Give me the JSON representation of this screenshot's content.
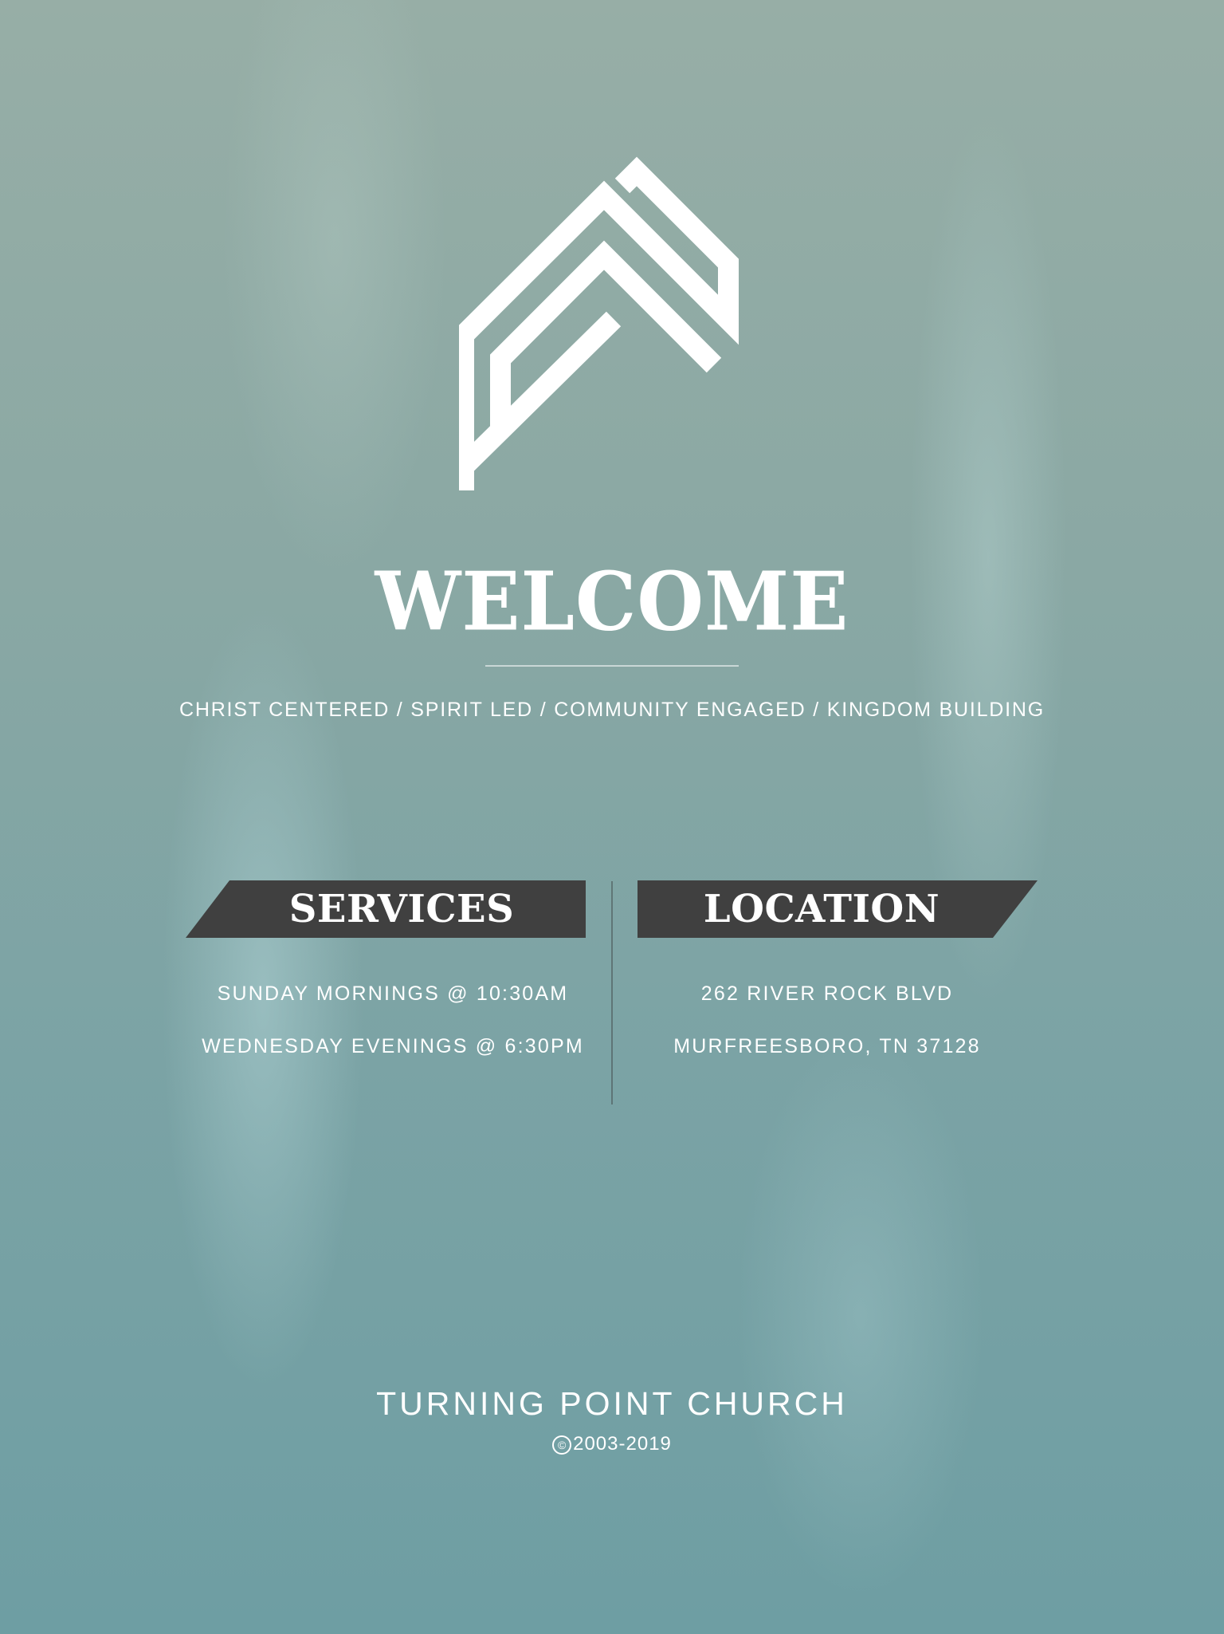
{
  "logo": {
    "icon": "chevron-house-logo-icon",
    "color": "#ffffff"
  },
  "heading": {
    "title": "WELCOME"
  },
  "tagline": "CHRIST CENTERED / SPIRIT LED / COMMUNITY ENGAGED / KINGDOM BUILDING",
  "services": {
    "label": "SERVICES",
    "lines": [
      "SUNDAY MORNINGS @ 10:30AM",
      "WEDNESDAY EVENINGS @ 6:30PM"
    ]
  },
  "location": {
    "label": "LOCATION",
    "lines": [
      "262 RIVER ROCK BLVD",
      "MURFREESBORO, TN 37128"
    ]
  },
  "footer": {
    "church_name": "TURNING POINT CHURCH",
    "copyright_symbol": "©",
    "years": "2003-2019"
  },
  "colors": {
    "banner_fill": "#404040",
    "text": "#ffffff",
    "background_teal": "#7ba3a5"
  }
}
